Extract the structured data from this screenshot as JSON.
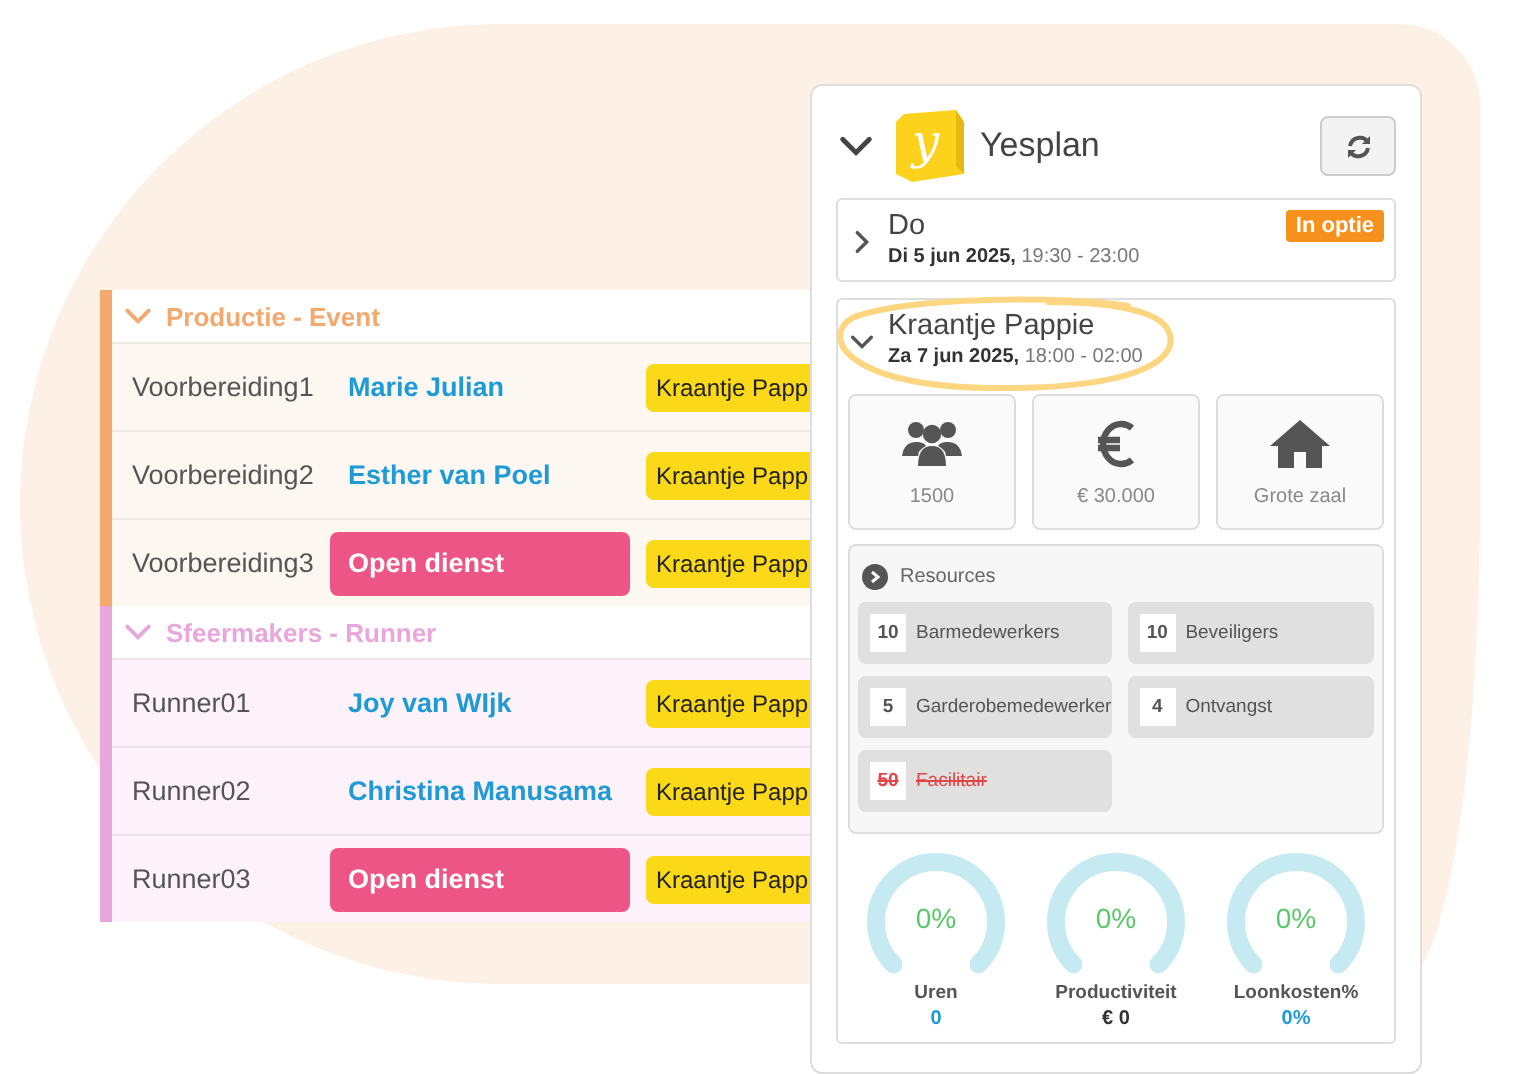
{
  "schedule": {
    "groups": [
      {
        "title": "Productie - Event",
        "color": "#f5a86e",
        "expanded": true,
        "rows": [
          {
            "role": "Voorbereiding1",
            "kind": "person",
            "person": "Marie Julian",
            "event": "Kraantje Papp"
          },
          {
            "role": "Voorbereiding2",
            "kind": "person",
            "person": "Esther van Poel",
            "event": "Kraantje Papp"
          },
          {
            "role": "Voorbereiding3",
            "kind": "open",
            "person": "Open dienst",
            "event": "Kraantje Papp"
          }
        ]
      },
      {
        "title": "Sfeermakers - Runner",
        "color": "#e9a6dc",
        "expanded": true,
        "rows": [
          {
            "role": "Runner01",
            "kind": "person",
            "person": "Joy van WIjk",
            "event": "Kraantje Papp"
          },
          {
            "role": "Runner02",
            "kind": "person",
            "person": "Christina Manusama",
            "event": "Kraantje Papp"
          },
          {
            "role": "Runner03",
            "kind": "open",
            "person": "Open dienst",
            "event": "Kraantje Papp"
          }
        ]
      }
    ]
  },
  "panel": {
    "title": "Yesplan",
    "logo_letter": "y",
    "expanded": true,
    "events": [
      {
        "name": "Do",
        "date": "Di 5 jun 2025,",
        "time": "19:30 - 23:00",
        "badge": "In optie",
        "expanded": false
      },
      {
        "name": "Kraantje Pappie",
        "date": "Za 7 jun 2025,",
        "time": "18:00 - 02:00",
        "expanded": true,
        "stats": [
          {
            "kind": "people",
            "label": "1500"
          },
          {
            "kind": "euro",
            "label": "€ 30.000"
          },
          {
            "kind": "house",
            "label": "Grote zaal"
          }
        ],
        "resources": {
          "title": "Resources",
          "items": [
            {
              "count": "10",
              "name": "Barmedewerkers",
              "struck": false
            },
            {
              "count": "10",
              "name": "Beveiligers",
              "struck": false
            },
            {
              "count": "5",
              "name": "Garderobemedewerker",
              "struck": false
            },
            {
              "count": "4",
              "name": "Ontvangst",
              "struck": false
            },
            {
              "count": "50",
              "name": "Facilitair",
              "struck": true
            }
          ]
        },
        "gauges": [
          {
            "label": "Uren",
            "reading": "0%",
            "value": "0"
          },
          {
            "label": "Productiviteit",
            "reading": "0%",
            "value": "€ 0"
          },
          {
            "label": "Loonkosten%",
            "reading": "0%",
            "value": "0%"
          }
        ]
      }
    ]
  }
}
